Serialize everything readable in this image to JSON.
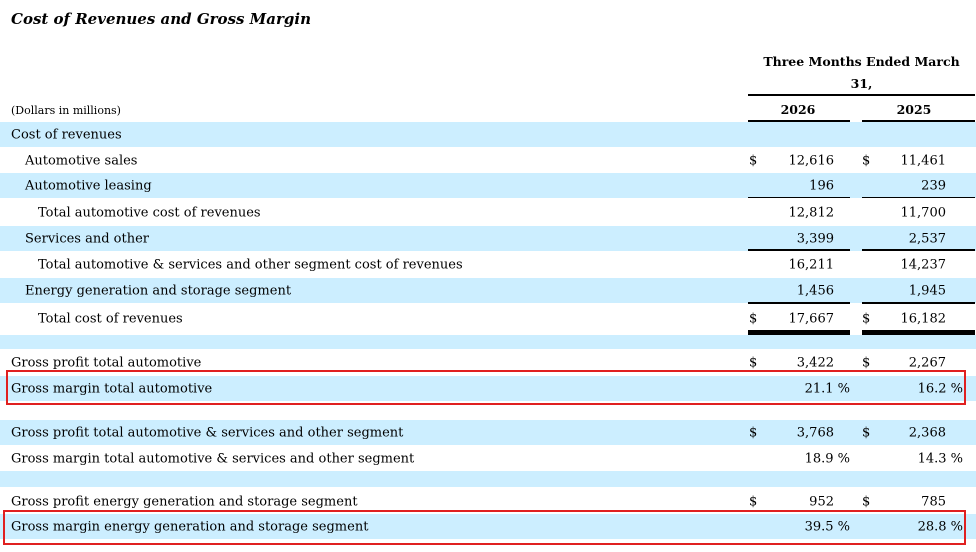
{
  "title": "Cost of Revenues and Gross Margin",
  "header": {
    "period_line1": "Three Months Ended March",
    "period_line2": "31,",
    "year1": "2026",
    "year2": "2025",
    "units": "(Dollars in millions)"
  },
  "colors": {
    "shade": "#cceeff",
    "highlight_box": "#e02020"
  },
  "rows": [
    {
      "label": "Cost of revenues",
      "y1": "",
      "y2": "",
      "dollar": false
    },
    {
      "label": "Automotive sales",
      "y1": "12,616",
      "y2": "11,461",
      "dollar": true
    },
    {
      "label": "Automotive leasing",
      "y1": "196",
      "y2": "239",
      "dollar": false
    },
    {
      "label": "Total automotive cost of revenues",
      "y1": "12,812",
      "y2": "11,700",
      "dollar": false
    },
    {
      "label": "Services and other",
      "y1": "3,399",
      "y2": "2,537",
      "dollar": false
    },
    {
      "label": "Total automotive & services and other segment cost of revenues",
      "y1": "16,211",
      "y2": "14,237",
      "dollar": false
    },
    {
      "label": "Energy generation and storage segment",
      "y1": "1,456",
      "y2": "1,945",
      "dollar": false
    },
    {
      "label": "Total cost of revenues",
      "y1": "17,667",
      "y2": "16,182",
      "dollar": true
    },
    {
      "label": "Gross profit total automotive",
      "y1": "3,422",
      "y2": "2,267",
      "dollar": true
    },
    {
      "label": "Gross margin total automotive",
      "y1": "21.1 %",
      "y2": "16.2 %",
      "dollar": false
    },
    {
      "label": "Gross profit total automotive & services and other segment",
      "y1": "3,768",
      "y2": "2,368",
      "dollar": true
    },
    {
      "label": "Gross margin total automotive & services and other segment",
      "y1": "18.9 %",
      "y2": "14.3 %",
      "dollar": false
    },
    {
      "label": "Gross profit energy generation and storage segment",
      "y1": "952",
      "y2": "785",
      "dollar": true
    },
    {
      "label": "Gross margin energy generation and storage segment",
      "y1": "39.5 %",
      "y2": "28.8 %",
      "dollar": false
    }
  ],
  "currency_symbol": "$"
}
